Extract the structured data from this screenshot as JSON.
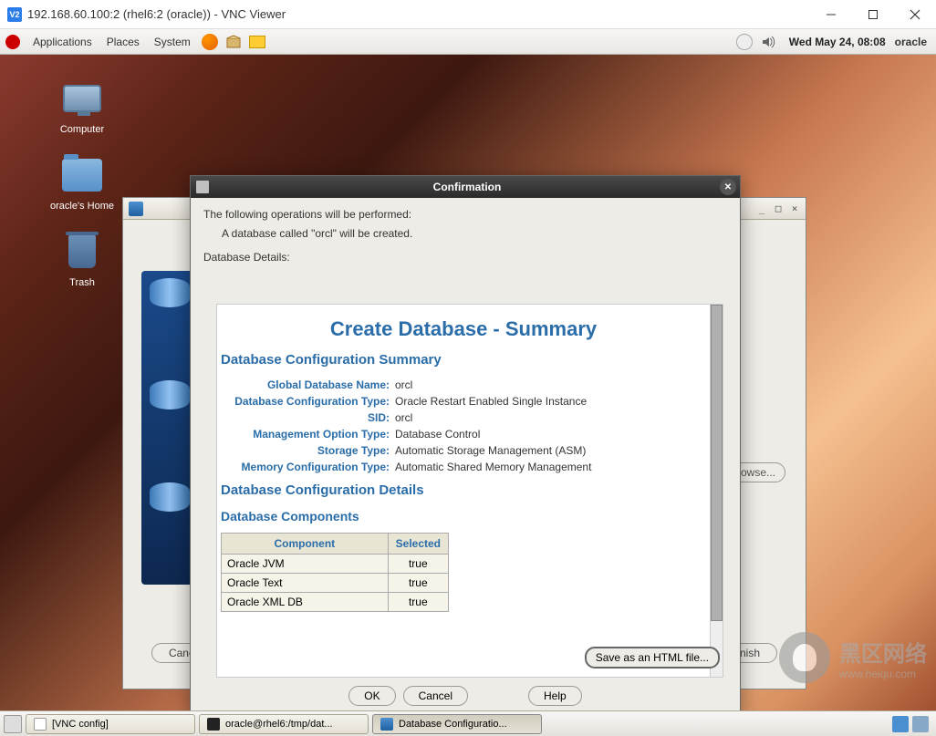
{
  "window": {
    "title": "192.168.60.100:2 (rhel6:2 (oracle)) - VNC Viewer"
  },
  "panel": {
    "applications": "Applications",
    "places": "Places",
    "system": "System",
    "clock": "Wed May 24, 08:08",
    "user": "oracle"
  },
  "desktop_icons": {
    "computer": "Computer",
    "home": "oracle's Home",
    "trash": "Trash"
  },
  "dbca_bg": {
    "browse": "Browse...",
    "cancel": "Cancel",
    "finish": "Einish"
  },
  "confirm": {
    "title": "Confirmation",
    "op_line1": "The following operations will be performed:",
    "op_line2": "A database called \"orcl\" will be created.",
    "details": "Database Details:",
    "summary_h": "Create Database - Summary",
    "cfg_summary_h": "Database Configuration Summary",
    "kv": [
      {
        "k": "Global Database Name:",
        "v": "orcl"
      },
      {
        "k": "Database Configuration Type:",
        "v": "Oracle Restart Enabled Single Instance"
      },
      {
        "k": "SID:",
        "v": "orcl"
      },
      {
        "k": "Management Option Type:",
        "v": "Database Control"
      },
      {
        "k": "Storage Type:",
        "v": "Automatic Storage Management (ASM)"
      },
      {
        "k": "Memory Configuration Type:",
        "v": "Automatic Shared Memory Management"
      }
    ],
    "cfg_details_h": "Database Configuration Details",
    "components_h": "Database Components",
    "comp_headers": {
      "c": "Component",
      "s": "Selected"
    },
    "components": [
      {
        "c": "Oracle JVM",
        "s": "true"
      },
      {
        "c": "Oracle Text",
        "s": "true"
      },
      {
        "c": "Oracle XML DB",
        "s": "true"
      }
    ],
    "save": "Save as an HTML file...",
    "ok": "OK",
    "cancel": "Cancel",
    "help": "Help"
  },
  "taskbar": {
    "t1": "[VNC config]",
    "t2": "oracle@rhel6:/tmp/dat...",
    "t3": "Database Configuratio..."
  },
  "watermark": {
    "t1": "黑区网络",
    "t2": "www.heiqu.com"
  }
}
